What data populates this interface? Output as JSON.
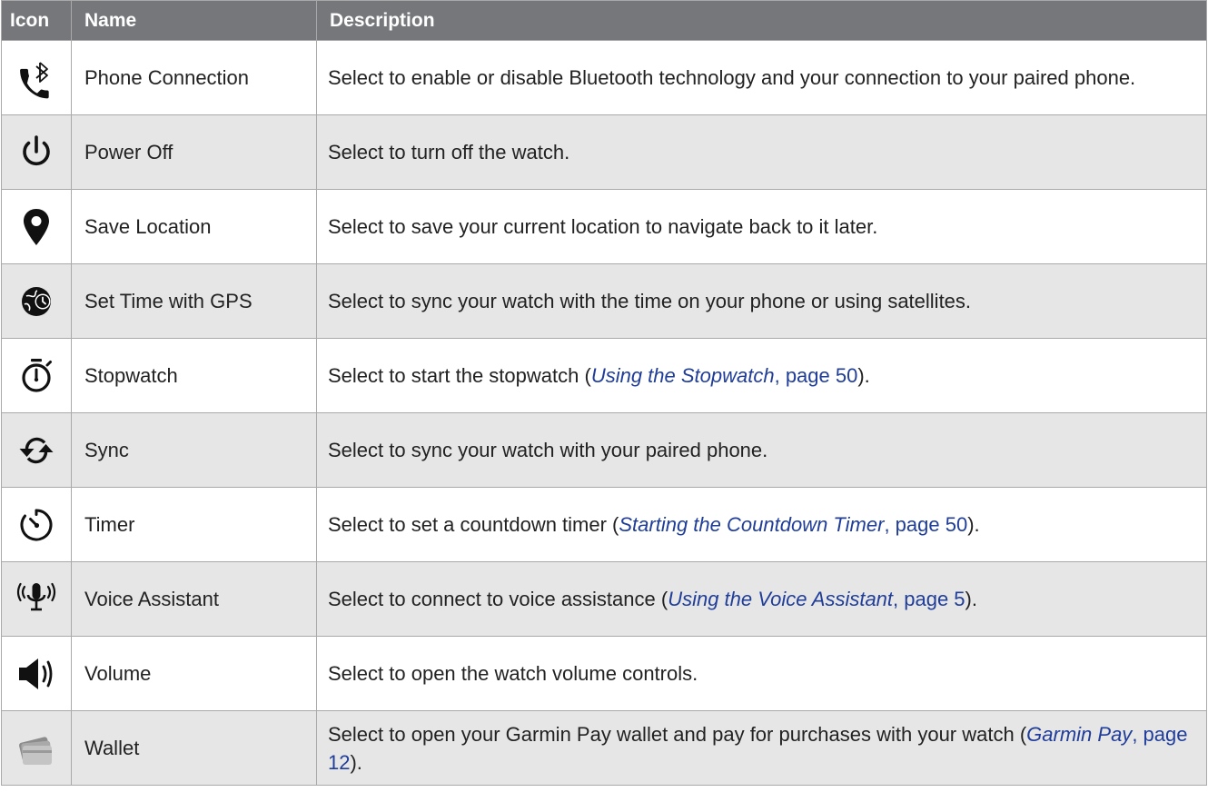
{
  "header": {
    "icon": "Icon",
    "name": "Name",
    "description": "Description"
  },
  "rows": [
    {
      "icon": "phone-bluetooth-icon",
      "name": "Phone Connection",
      "description": "Select to enable or disable Bluetooth technology and your connection to your paired phone."
    },
    {
      "icon": "power-icon",
      "name": "Power Off",
      "description": "Select to turn off the watch."
    },
    {
      "icon": "location-pin-icon",
      "name": "Save Location",
      "description": "Select to save your current location to navigate back to it later."
    },
    {
      "icon": "globe-clock-icon",
      "name": "Set Time with GPS",
      "description": "Select to sync your watch with the time on your phone or using satellites."
    },
    {
      "icon": "stopwatch-icon",
      "name": "Stopwatch",
      "description_before": "Select to start the stopwatch (",
      "link_title": "Using the Stopwatch",
      "link_page": ", page 50",
      "description_after": ")."
    },
    {
      "icon": "sync-icon",
      "name": "Sync",
      "description": "Select to sync your watch with your paired phone."
    },
    {
      "icon": "timer-icon",
      "name": "Timer",
      "description_before": "Select to set a countdown timer (",
      "link_title": "Starting the Countdown Timer",
      "link_page": ", page 50",
      "description_after": ")."
    },
    {
      "icon": "microphone-icon",
      "name": "Voice Assistant",
      "description_before": "Select to connect to voice assistance (",
      "link_title": "Using the Voice Assistant",
      "link_page": ", page 5",
      "description_after": ")."
    },
    {
      "icon": "speaker-icon",
      "name": "Volume",
      "description": "Select to open the watch volume controls."
    },
    {
      "icon": "wallet-icon",
      "name": "Wallet",
      "description_before": "Select to open your Garmin Pay wallet and pay for purchases with your watch (",
      "link_title": "Garmin Pay",
      "link_page": ", page 12",
      "description_after": ")."
    }
  ]
}
